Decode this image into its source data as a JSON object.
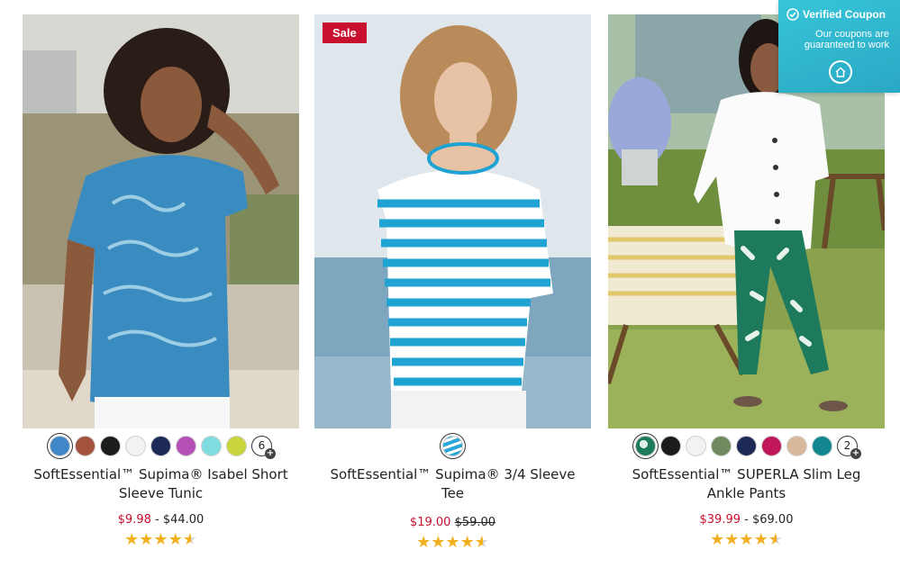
{
  "products": [
    {
      "title": "SoftEssential™ Supima® Isabel Short Sleeve Tunic",
      "price_sale": "$9.98",
      "price_sep": "-",
      "price_regular": "$44.00",
      "badge": "",
      "rating": 4.5,
      "swatches": [
        "#3f87c6",
        "#a3523d",
        "#1c1c1c",
        "#f2f2f2",
        "#1d2a57",
        "#b64fb6",
        "#7fdde0",
        "#c9d63b"
      ],
      "more_count": "6",
      "more_plus": "+"
    },
    {
      "title": "SoftEssential™ Supima® 3/4 Sleeve Tee",
      "price_sale": "$19.00",
      "price_original": "$59.00",
      "badge": "Sale",
      "rating": 4.5,
      "swatches": [
        "#2aa6d8"
      ]
    },
    {
      "title": "SoftEssential™ SUPERLA Slim Leg Ankle Pants",
      "price_sale": "$39.99",
      "price_sep": "-",
      "price_regular": "$69.00",
      "badge": "",
      "rating": 4.5,
      "swatches": [
        "#1e7a5c",
        "#1c1c1c",
        "#f2f2f2",
        "#6e8a5e",
        "#1d2a57",
        "#c0165a",
        "#d9b79b",
        "#12878f"
      ],
      "more_count": "2",
      "more_plus": "+"
    }
  ],
  "coupon": {
    "title": "Verified Coupon",
    "subtitle_line1": "Our coupons are",
    "subtitle_line2": "guaranteed to work",
    "logo": "home-icon"
  },
  "colors": {
    "sale_red": "#c8102e",
    "star_gold": "#f2b01e",
    "coupon_teal": "#2fb6cc"
  }
}
